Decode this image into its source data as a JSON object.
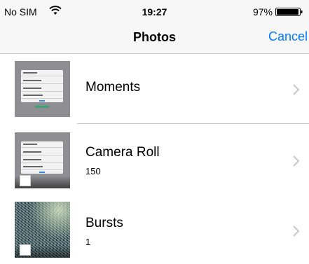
{
  "status_bar": {
    "carrier": "No SIM",
    "wifi_icon": "wifi-icon",
    "time": "19:27",
    "battery_percent": "97%",
    "battery_level": 0.97
  },
  "nav": {
    "title": "Photos",
    "cancel_label": "Cancel"
  },
  "albums": [
    {
      "title": "Moments",
      "count": "",
      "thumbnail": "settings-screenshot"
    },
    {
      "title": "Camera Roll",
      "count": "150",
      "thumbnail": "settings-screenshot"
    },
    {
      "title": "Bursts",
      "count": "1",
      "thumbnail": "noise-photo"
    }
  ],
  "colors": {
    "accent": "#007aff",
    "separator": "#c8c7cc",
    "bar_background": "#f7f7f7",
    "chevron": "#c7c7cc"
  }
}
